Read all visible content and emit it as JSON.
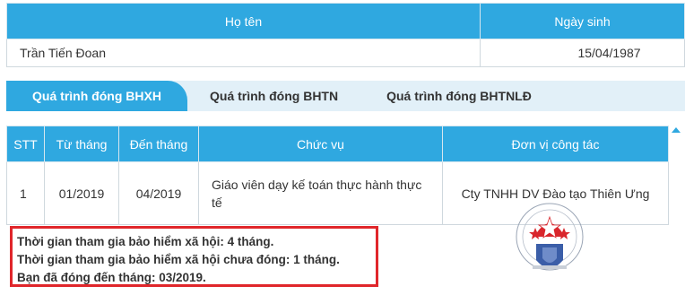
{
  "info_table": {
    "headers": {
      "name": "Họ tên",
      "dob": "Ngày sinh"
    },
    "row": {
      "name": "Trần Tiến Đoan",
      "dob": "15/04/1987"
    }
  },
  "tabs": [
    {
      "label": "Quá trình đóng BHXH",
      "active": true
    },
    {
      "label": "Quá trình đóng BHTN",
      "active": false
    },
    {
      "label": "Quá trình đóng BHTNLĐ",
      "active": false
    }
  ],
  "contrib_table": {
    "headers": {
      "stt": "STT",
      "from": "Từ tháng",
      "to": "Đến tháng",
      "position": "Chức vụ",
      "unit": "Đơn vị công tác"
    },
    "rows": [
      {
        "stt": "1",
        "from": "01/2019",
        "to": "04/2019",
        "position": "Giáo viên dạy kế toán thực hành thực tế",
        "unit": "Cty TNHH DV Đào tạo Thiên Ưng"
      }
    ]
  },
  "summary": {
    "line1": "Thời gian tham gia bảo hiểm xã hội: 4 tháng.",
    "line2": "Thời gian tham gia bảo hiểm xã hội chưa đóng: 1 tháng.",
    "line3": "Bạn đã đóng đến tháng: 03/2019."
  },
  "colors": {
    "header_blue": "#2fa8e0",
    "tab_bar_bg": "#e2f0f8",
    "highlight_border": "#e0262b",
    "stamp_red": "#d9262c",
    "shield_blue": "#3b5ea8"
  },
  "stamp": {
    "icon": "company-seal-icon"
  }
}
